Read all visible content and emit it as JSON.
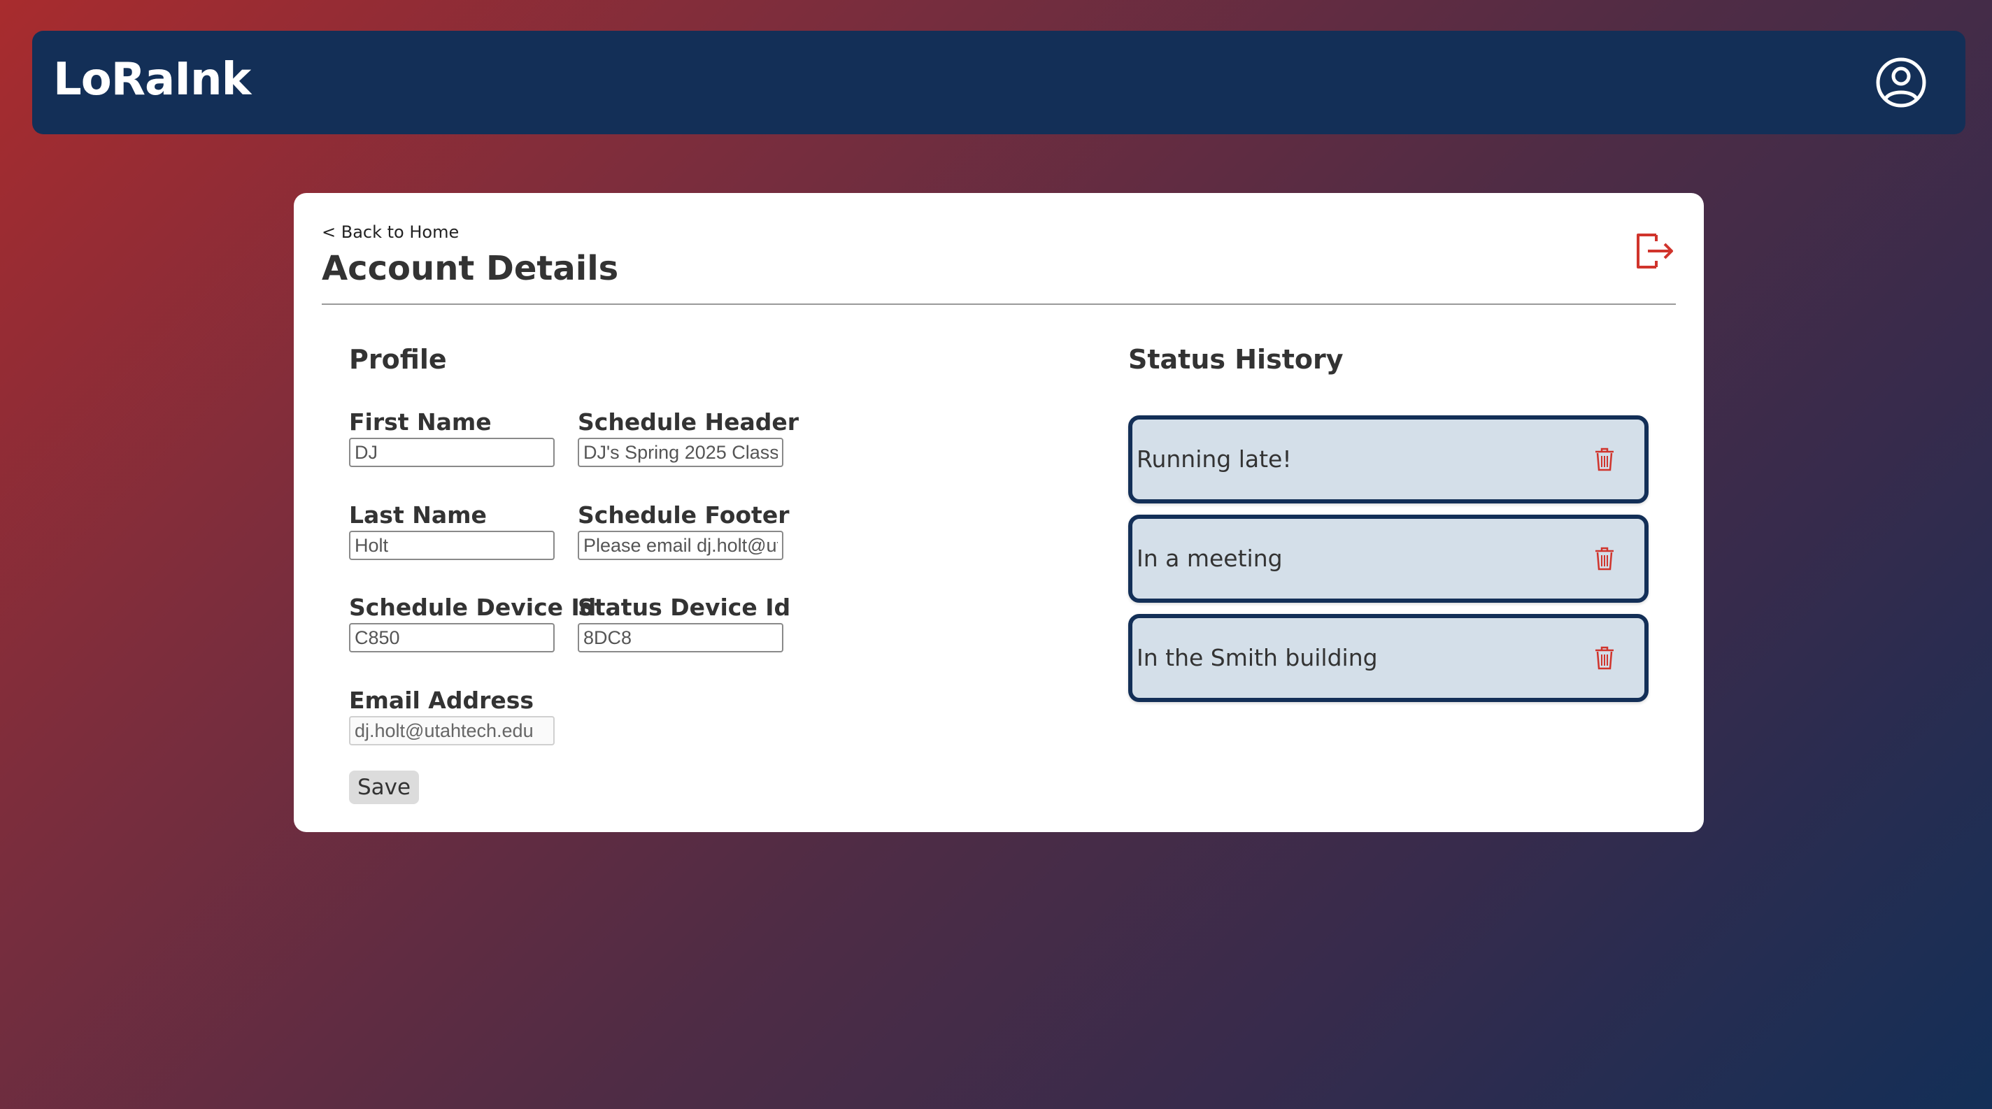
{
  "app": {
    "title": "LoRaInk"
  },
  "header": {
    "user_icon": "user-circle-icon"
  },
  "nav": {
    "back_label": "< Back to Home"
  },
  "page": {
    "title": "Account Details",
    "logout_icon": "logout-icon"
  },
  "profile": {
    "title": "Profile",
    "first_name": {
      "label": "First Name",
      "value": "DJ"
    },
    "schedule_header": {
      "label": "Schedule Header",
      "value": "DJ's Spring 2025 Class"
    },
    "last_name": {
      "label": "Last Name",
      "value": "Holt"
    },
    "schedule_footer": {
      "label": "Schedule Footer",
      "value": "Please email dj.holt@utahtech.edu"
    },
    "schedule_device_id": {
      "label": "Schedule Device Id",
      "value": "C850"
    },
    "status_device_id": {
      "label": "Status Device Id",
      "value": "8DC8"
    },
    "email": {
      "label": "Email Address",
      "value": "dj.holt@utahtech.edu"
    },
    "save_label": "Save"
  },
  "status_history": {
    "title": "Status History",
    "items": [
      {
        "text": "Running late!"
      },
      {
        "text": "In a meeting"
      },
      {
        "text": "In the Smith building"
      }
    ],
    "delete_icon": "trash-icon"
  },
  "colors": {
    "navy": "#132f57",
    "accent_red": "#d0342c",
    "status_bg": "#d4dfe9"
  }
}
